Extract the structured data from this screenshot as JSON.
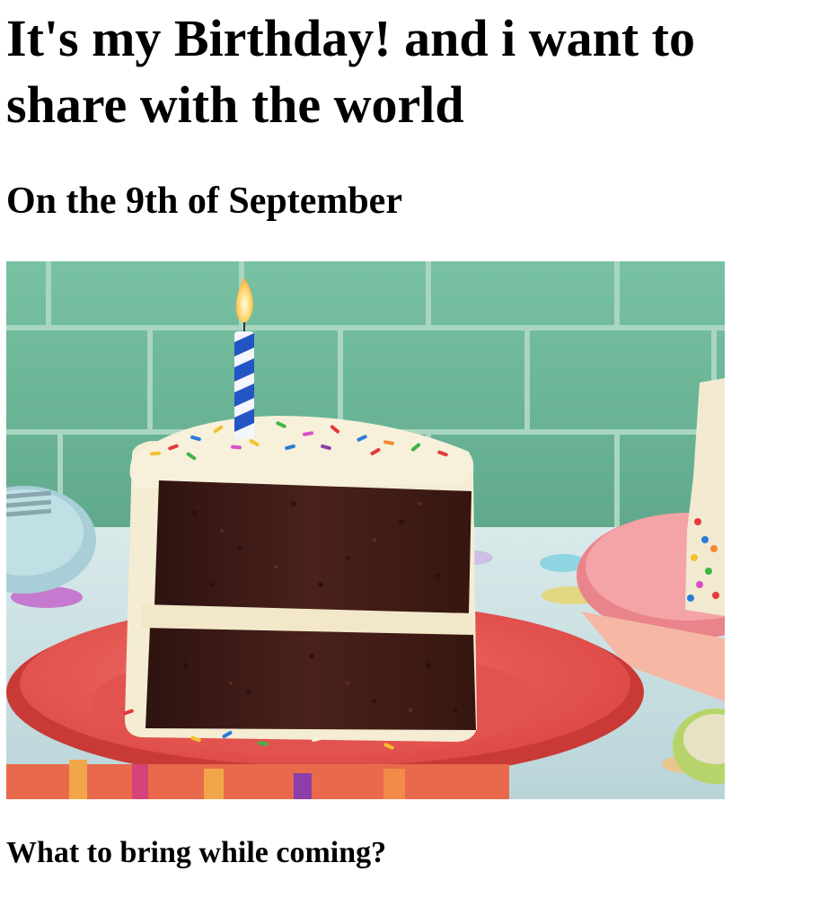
{
  "page": {
    "title": "It's my Birthday! and i want to share with the world",
    "subtitle": "On the 9th of September",
    "section_heading": "What to bring while coming?"
  },
  "image": {
    "icon": "birthday-cake-slice-photo",
    "colors": {
      "tile_wall": "#6fb89b",
      "grout": "#a9d6c1",
      "plate": "#e85a55",
      "cake": "#3b1a16",
      "frosting": "#f4ecd3",
      "candle": "#2455c4",
      "table": "#cfe3e6"
    }
  }
}
